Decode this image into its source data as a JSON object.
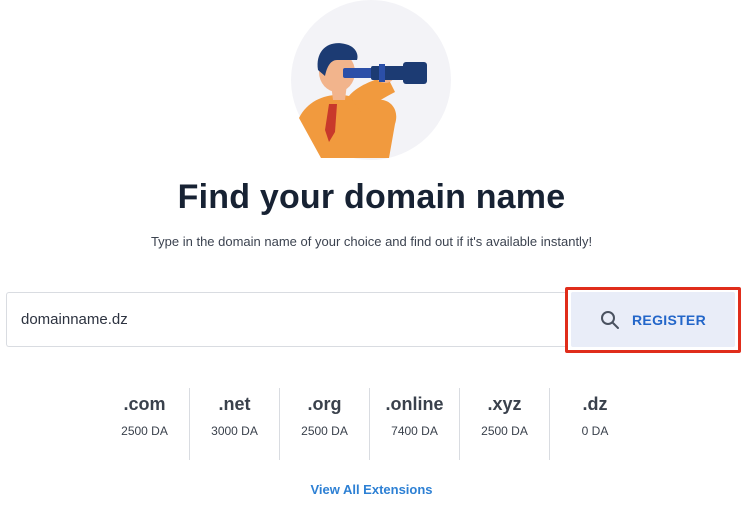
{
  "hero": {
    "icon": "man-with-telescope-illustration"
  },
  "title": "Find your domain name",
  "subtitle": "Type in the domain name of your choice and find out if it's available instantly!",
  "search": {
    "value": "domainname.dz",
    "button_label": "REGISTER",
    "button_icon": "search-icon",
    "highlight_color": "#e02d1b"
  },
  "extensions": [
    {
      "name": ".com",
      "price": "2500 DA"
    },
    {
      "name": ".net",
      "price": "3000 DA"
    },
    {
      "name": ".org",
      "price": "2500 DA"
    },
    {
      "name": ".online",
      "price": "7400 DA"
    },
    {
      "name": ".xyz",
      "price": "2500 DA"
    },
    {
      "name": ".dz",
      "price": "0 DA"
    }
  ],
  "view_all_label": "View All Extensions",
  "colors": {
    "accent": "#2366c9",
    "link": "#2d80d4",
    "button_bg": "#e9edf8",
    "title": "#172233"
  }
}
